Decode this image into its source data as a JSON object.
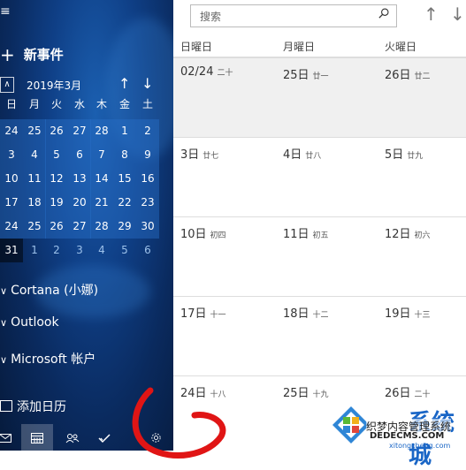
{
  "sidebar": {
    "new_event": "新事件",
    "month_label": "2019年3月",
    "weekdays": [
      "日",
      "月",
      "火",
      "水",
      "木",
      "金",
      "土"
    ],
    "mini_days": [
      [
        "24",
        "25",
        "26",
        "27",
        "28",
        "1",
        "2"
      ],
      [
        "3",
        "4",
        "5",
        "6",
        "7",
        "8",
        "9"
      ],
      [
        "10",
        "11",
        "12",
        "13",
        "14",
        "15",
        "16"
      ],
      [
        "17",
        "18",
        "19",
        "20",
        "21",
        "22",
        "23"
      ],
      [
        "24",
        "25",
        "26",
        "27",
        "28",
        "29",
        "30"
      ],
      [
        "31",
        "1",
        "2",
        "3",
        "4",
        "5",
        "6"
      ]
    ],
    "groups": [
      "Cortana (小娜)",
      "Outlook",
      "Microsoft 帐户"
    ],
    "add_calendar": "添加日历"
  },
  "search": {
    "placeholder": "搜索"
  },
  "main": {
    "headers": [
      "日曜日",
      "月曜日",
      "火曜日"
    ],
    "weeks": [
      [
        {
          "d": "02/24",
          "l": "二十"
        },
        {
          "d": "25日",
          "l": "廿一"
        },
        {
          "d": "26日",
          "l": "廿二"
        }
      ],
      [
        {
          "d": "3日",
          "l": "廿七"
        },
        {
          "d": "4日",
          "l": "廿八"
        },
        {
          "d": "5日",
          "l": "廿九"
        }
      ],
      [
        {
          "d": "10日",
          "l": "初四"
        },
        {
          "d": "11日",
          "l": "初五"
        },
        {
          "d": "12日",
          "l": "初六"
        }
      ],
      [
        {
          "d": "17日",
          "l": "十一"
        },
        {
          "d": "18日",
          "l": "十二"
        },
        {
          "d": "19日",
          "l": "十三"
        }
      ],
      [
        {
          "d": "24日",
          "l": "十八"
        },
        {
          "d": "25日",
          "l": "十九"
        },
        {
          "d": "26日",
          "l": "二十"
        }
      ]
    ]
  },
  "watermark": {
    "brand": "系统城",
    "line1": "织梦内容管理系统",
    "line2": "DEDECMS.COM",
    "line3": "xitongcheng.com"
  },
  "colors": {
    "sidebar_bg": "#0f3f86",
    "accent": "#1a66c6",
    "red_mark": "#e01515"
  }
}
